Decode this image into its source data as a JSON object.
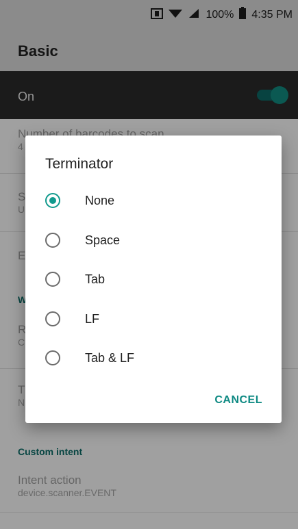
{
  "status_bar": {
    "signal_icon": "nfc-icon",
    "battery_percent": "100%",
    "time": "4:35 PM"
  },
  "appbar": {
    "title": "Basic"
  },
  "switch": {
    "label": "On",
    "state": "on"
  },
  "background": {
    "row1_title": "Number of barcodes to scan",
    "row1_sub": "4",
    "row2_title": "S",
    "row2_sub": "U",
    "row3_title": "E",
    "section1": "W",
    "row4_title": "R",
    "row4_sub": "C",
    "row5_title": "T",
    "row5_sub": "N",
    "section2": "Custom intent",
    "row6_title": "Intent action",
    "row6_sub": "device.scanner.EVENT"
  },
  "dialog": {
    "title": "Terminator",
    "options": [
      "None",
      "Space",
      "Tab",
      "LF",
      "Tab & LF"
    ],
    "selected_index": 0,
    "cancel_label": "CANCEL"
  },
  "colors": {
    "accent": "#119a8d",
    "dark_bar": "#2a2a2a"
  }
}
